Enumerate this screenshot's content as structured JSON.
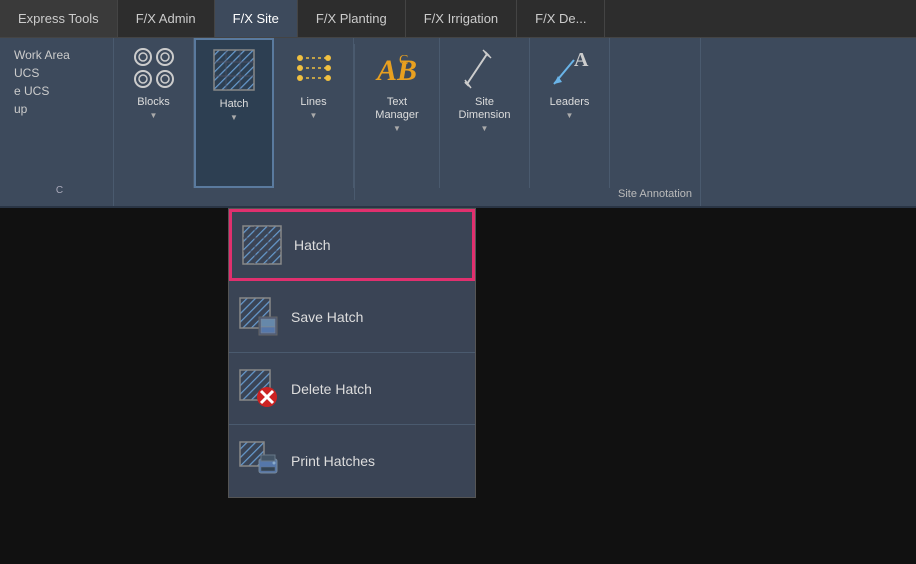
{
  "tabs": [
    {
      "id": "express",
      "label": "Express Tools",
      "active": false
    },
    {
      "id": "fxadmin",
      "label": "F/X Admin",
      "active": false
    },
    {
      "id": "fxsite",
      "label": "F/X Site",
      "active": true
    },
    {
      "id": "fxplanting",
      "label": "F/X Planting",
      "active": false
    },
    {
      "id": "fxirrigation",
      "label": "F/X Irrigation",
      "active": false
    },
    {
      "id": "fxde",
      "label": "F/X De...",
      "active": false
    }
  ],
  "left_panel": {
    "items": [
      "Work Area",
      "UCS",
      "e UCS",
      "up"
    ]
  },
  "ribbon_buttons": [
    {
      "id": "blocks",
      "label": "Blocks",
      "has_arrow": true
    },
    {
      "id": "hatch",
      "label": "Hatch",
      "has_arrow": true,
      "active": true
    },
    {
      "id": "lines",
      "label": "Lines",
      "has_arrow": true
    },
    {
      "id": "text_manager",
      "label": "Text\nManager",
      "has_arrow": true
    },
    {
      "id": "site_dimension",
      "label": "Site\nDimension",
      "has_arrow": true
    },
    {
      "id": "leaders",
      "label": "Leaders",
      "has_arrow": true
    }
  ],
  "site_annotation_label": "Site Annotation",
  "left_group_label": "C",
  "dropdown": {
    "items": [
      {
        "id": "hatch",
        "label": "Hatch",
        "highlighted": true
      },
      {
        "id": "save_hatch",
        "label": "Save Hatch",
        "highlighted": false
      },
      {
        "id": "delete_hatch",
        "label": "Delete Hatch",
        "highlighted": false
      },
      {
        "id": "print_hatches",
        "label": "Print Hatches",
        "highlighted": false
      }
    ]
  }
}
